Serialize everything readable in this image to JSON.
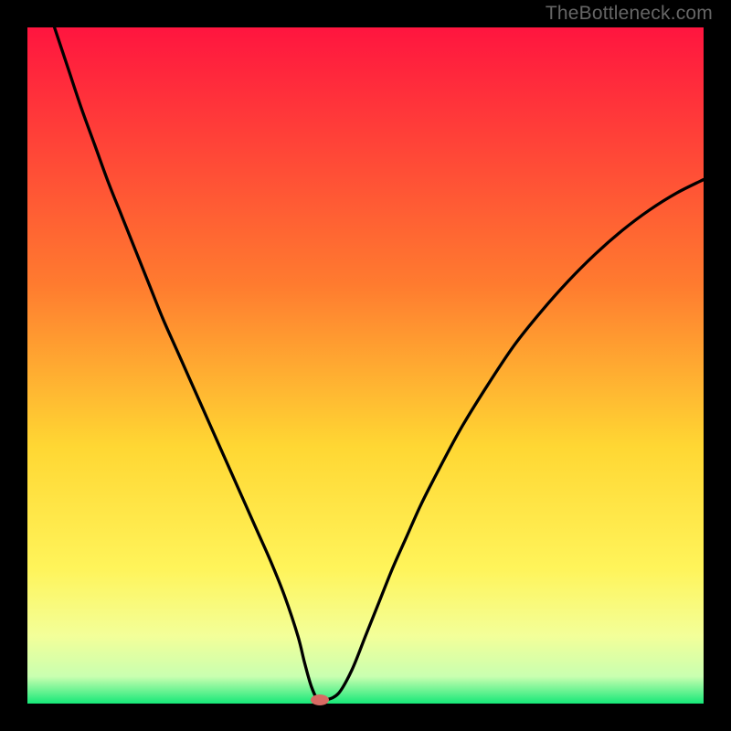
{
  "watermark": "TheBottleneck.com",
  "chart_data": {
    "type": "line",
    "title": "",
    "xlabel": "",
    "ylabel": "",
    "xlim": [
      0,
      100
    ],
    "ylim": [
      0,
      100
    ],
    "series": [
      {
        "name": "bottleneck-curve",
        "x": [
          4,
          6,
          8,
          10,
          12,
          14,
          16,
          18,
          20,
          22,
          24,
          26,
          28,
          30,
          32,
          34,
          36,
          38,
          40,
          41,
          42,
          43,
          44,
          46,
          48,
          50,
          52,
          54,
          56,
          58,
          60,
          64,
          68,
          72,
          76,
          80,
          84,
          88,
          92,
          96,
          100
        ],
        "values": [
          100,
          94,
          88,
          82.5,
          77,
          72,
          67,
          62,
          57,
          52.5,
          48,
          43.5,
          39,
          34.5,
          30,
          25.5,
          21,
          16,
          10,
          6,
          2.5,
          0.5,
          0.5,
          1.5,
          5,
          10,
          15,
          20,
          24.5,
          29,
          33,
          40.5,
          47,
          53,
          58,
          62.5,
          66.5,
          70,
          73,
          75.5,
          77.5
        ]
      }
    ],
    "gradient_colors": {
      "top": "#ff153f",
      "mid1": "#ff7b2f",
      "mid2": "#ffd733",
      "mid3": "#fff45a",
      "mid4": "#f3ff99",
      "mid5": "#c9ffb0",
      "bottom": "#16e878"
    },
    "minimum_marker": {
      "x": 43.2,
      "y": 0.5,
      "color": "#d86a63",
      "rx": 10,
      "ry": 6
    },
    "grid": false,
    "legend": false
  }
}
